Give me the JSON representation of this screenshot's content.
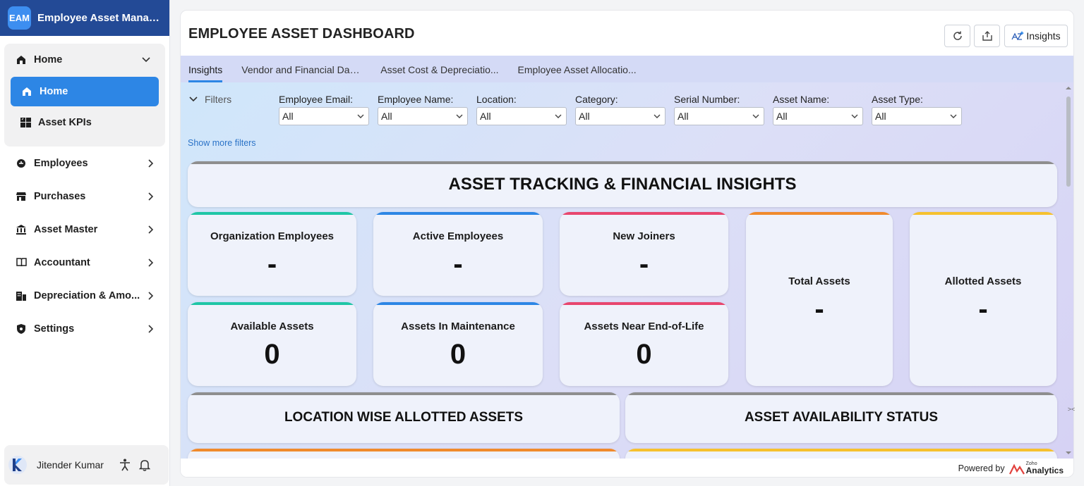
{
  "app": {
    "logo_text": "EAM",
    "title": "Employee Asset Manage..."
  },
  "sidebar": {
    "home_group": {
      "label": "Home",
      "items": [
        {
          "label": "Home"
        },
        {
          "label": "Asset KPIs"
        }
      ]
    },
    "items": [
      {
        "label": "Employees",
        "icon": "employees-icon"
      },
      {
        "label": "Purchases",
        "icon": "store-icon"
      },
      {
        "label": "Asset Master",
        "icon": "bank-icon"
      },
      {
        "label": "Accountant",
        "icon": "book-icon"
      },
      {
        "label": "Depreciation & Amo...",
        "icon": "building-icon"
      },
      {
        "label": "Settings",
        "icon": "shield-icon"
      }
    ]
  },
  "user": {
    "name": "Jitender Kumar"
  },
  "dashboard": {
    "title": "EMPLOYEE ASSET DASHBOARD",
    "toolbar": {
      "insights_label": "Insights"
    },
    "tabs": [
      {
        "label": "Insights"
      },
      {
        "label": "Vendor and Financial Das..."
      },
      {
        "label": "Asset Cost & Depreciatio..."
      },
      {
        "label": "Employee Asset Allocatio..."
      }
    ],
    "filters": {
      "label": "Filters",
      "items": [
        {
          "label": "Employee Email:",
          "value": "All"
        },
        {
          "label": "Employee Name:",
          "value": "All"
        },
        {
          "label": "Location:",
          "value": "All"
        },
        {
          "label": "Category:",
          "value": "All"
        },
        {
          "label": "Serial Number:",
          "value": "All"
        },
        {
          "label": "Asset Name:",
          "value": "All"
        },
        {
          "label": "Asset Type:",
          "value": "All"
        }
      ],
      "show_more": "Show more filters"
    },
    "banner": "ASSET TRACKING & FINANCIAL INSIGHTS",
    "kpis": [
      {
        "title": "Organization Employees",
        "value": "-",
        "color": "#1fc6a6"
      },
      {
        "title": "Active Employees",
        "value": "-",
        "color": "#2d86e5"
      },
      {
        "title": "New Joiners",
        "value": "-",
        "color": "#e8466e"
      },
      {
        "title": "Available Assets",
        "value": "0",
        "color": "#1fc6a6"
      },
      {
        "title": "Assets In Maintenance",
        "value": "0",
        "color": "#2d86e5"
      },
      {
        "title": "Assets Near End-of-Life",
        "value": "0",
        "color": "#e8466e"
      },
      {
        "title": "Total Assets",
        "value": "-",
        "color": "#f08a2c"
      },
      {
        "title": "Allotted Assets",
        "value": "-",
        "color": "#f6c12e"
      }
    ],
    "sections": [
      {
        "title": "LOCATION WISE ALLOTTED ASSETS"
      },
      {
        "title": "ASSET AVAILABILITY STATUS"
      }
    ],
    "footer": {
      "powered_by": "Powered by",
      "brand_small": "Zoho",
      "brand_big": "Analytics"
    }
  }
}
